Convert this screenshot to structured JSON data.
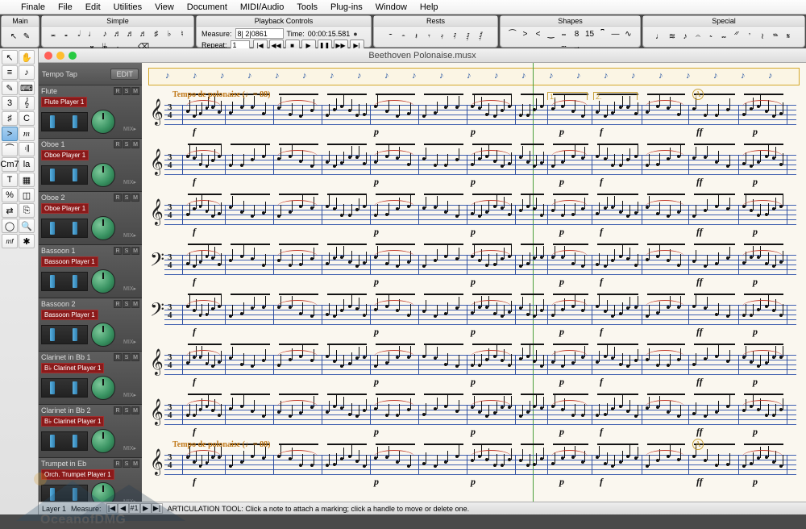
{
  "menubar": {
    "apple": "",
    "items": [
      "Finale",
      "File",
      "Edit",
      "Utilities",
      "View",
      "Document",
      "MIDI/Audio",
      "Tools",
      "Plug-ins",
      "Window",
      "Help"
    ]
  },
  "palettes": {
    "main": {
      "title": "Main"
    },
    "simple": {
      "title": "Simple"
    },
    "playback": {
      "title": "Playback Controls",
      "measure_label": "Measure:",
      "measure_value": "8| 2|0861",
      "time_label": "Time:",
      "time_value": "00:00:15.581",
      "repeat_label": "Repeat:",
      "repeat_value": "1"
    },
    "rests": {
      "title": "Rests"
    },
    "shapes": {
      "title": "Shapes"
    },
    "special": {
      "title": "Special"
    }
  },
  "document": {
    "title": "Beethoven Polonaise.musx"
  },
  "mixer": {
    "tempo_tap": "Tempo Tap",
    "edit": "EDIT",
    "rsm": [
      "R",
      "S",
      "M"
    ],
    "mix": "MIX▸",
    "channels": [
      {
        "name": "Flute",
        "player": "Flute Player 1"
      },
      {
        "name": "Oboe 1",
        "player": "Oboe Player 1"
      },
      {
        "name": "Oboe 2",
        "player": "Oboe Player 1"
      },
      {
        "name": "Bassoon 1",
        "player": "Bassoon Player 1"
      },
      {
        "name": "Bassoon 2",
        "player": "Bassoon Player 1"
      },
      {
        "name": "Clarinet in Bb 1",
        "player": "B♭ Clarinet Player 1"
      },
      {
        "name": "Clarinet in Bb 2",
        "player": "B♭ Clarinet Player 1"
      },
      {
        "name": "Trumpet in Eb",
        "player": "Orch. Trumpet Player 1"
      }
    ]
  },
  "score": {
    "tempo_glyph": "♪",
    "tempo_text": "Tempo de polonaise (♩= 88)",
    "volta1": "1.",
    "volta2": "2.",
    "rehearsal": "A",
    "dynamics": {
      "f": "f",
      "p": "p",
      "ff": "ff"
    },
    "timesig_top": "3",
    "timesig_bot": "4",
    "clefs": {
      "treble": "𝄞",
      "bass": "𝄢"
    }
  },
  "statusbar": {
    "layer": "Layer 1",
    "measure": "Measure:",
    "nav": [
      "|◀",
      "◀",
      "#1",
      "▶",
      "▶|"
    ],
    "hint": "ARTICULATION TOOL: Click a note to attach a marking; click a handle to move or delete one."
  },
  "watermark": "OceanofDMG"
}
